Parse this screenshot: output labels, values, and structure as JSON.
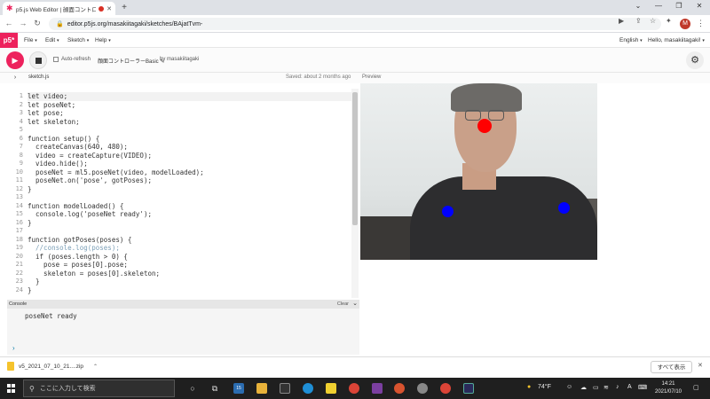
{
  "browser": {
    "tab_title": "p5.js Web Editor | 顔面コントロ",
    "new_tab": "+",
    "url": "editor.p5js.org/masakiitagaki/sketches/BAjatTvm-",
    "profile_initial": "M"
  },
  "p5": {
    "logo": "p5*",
    "menus": [
      "File",
      "Edit",
      "Sketch",
      "Help"
    ],
    "language": "English",
    "greeting": "Hello, masakiitagaki!",
    "auto_refresh_label": "Auto-refresh",
    "sketch_name": "顔面コントローラーBasic",
    "by_user": "by masakiitagaki",
    "file_name": "sketch.js",
    "saved_status": "Saved: about 2 months ago",
    "preview_label": "Preview"
  },
  "editor": {
    "line_numbers": [
      "1",
      "2",
      "3",
      "4",
      "5",
      "6",
      "7",
      "8",
      "9",
      "10",
      "11",
      "12",
      "13",
      "14",
      "15",
      "16",
      "17",
      "18",
      "19",
      "20",
      "21",
      "22",
      "23",
      "24"
    ],
    "lines": [
      "let video;",
      "let poseNet;",
      "let pose;",
      "let skeleton;",
      "",
      "function setup() {",
      "  createCanvas(640, 480);",
      "  video = createCapture(VIDEO);",
      "  video.hide();",
      "  poseNet = ml5.poseNet(video, modelLoaded);",
      "  poseNet.on('pose', gotPoses);",
      "}",
      "",
      "function modelLoaded() {",
      "  console.log('poseNet ready');",
      "}",
      "",
      "function gotPoses(poses) {",
      "  //console.log(poses);",
      "  if (poses.length > 0) {",
      "    pose = poses[0].pose;",
      "    skeleton = poses[0].skeleton;",
      "  }",
      "}"
    ]
  },
  "console": {
    "label": "Console",
    "clear": "Clear",
    "output": "poseNet ready"
  },
  "download": {
    "file": "v5_2021_07_10_21....zip",
    "show_all": "すべて表示"
  },
  "taskbar": {
    "search_placeholder": "ここに入力して検索",
    "badge": "15",
    "weather": "74°F",
    "ime": "A",
    "time": "14:21",
    "date": "2021/07/10"
  },
  "colors": {
    "p5_accent": "#ed225d",
    "nose_point": "#ff0000",
    "shoulder_point": "#0000ff"
  }
}
